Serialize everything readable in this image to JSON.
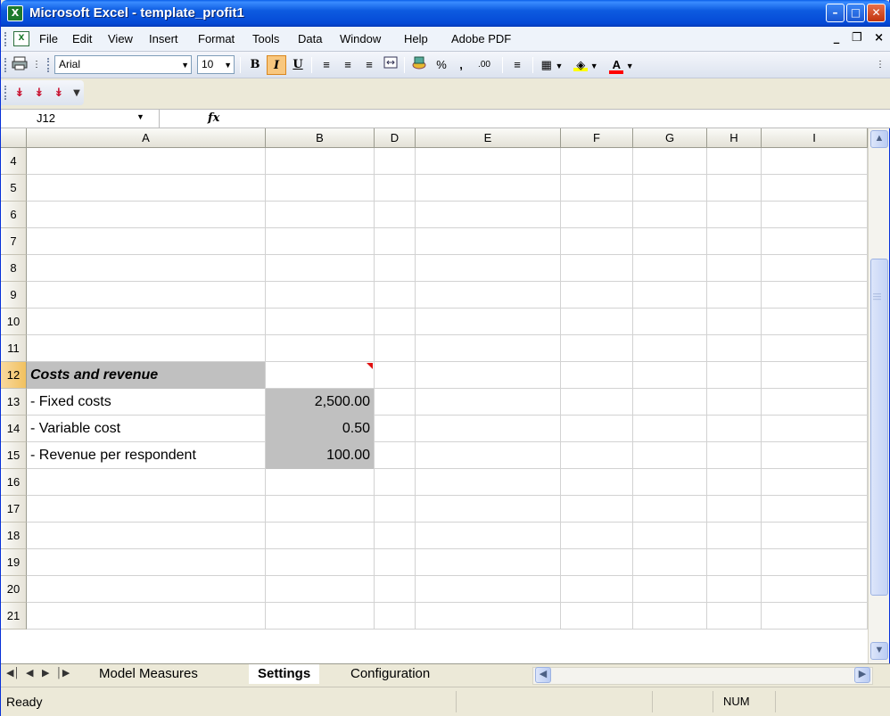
{
  "window": {
    "title": "Microsoft Excel - template_profit1",
    "app_icon": "excel-icon",
    "min_label": "–",
    "max_label": "□",
    "close_label": "✕"
  },
  "menu": {
    "items": [
      "File",
      "Edit",
      "View",
      "Insert",
      "Format",
      "Tools",
      "Data",
      "Window",
      "Help",
      "Adobe PDF"
    ],
    "doc_min": "_",
    "doc_restore": "❐",
    "doc_close": "×"
  },
  "toolbar": {
    "font_name": "Arial",
    "font_size": "10",
    "bold": "B",
    "italic": "I",
    "underline": "U",
    "percent": "%",
    "comma": ",",
    "increase_decimal": ".00",
    "fill_color": "#FFFF00",
    "font_color": "#FF0000"
  },
  "formula_bar": {
    "name_box": "J12",
    "fx_label": "fx",
    "formula": ""
  },
  "grid": {
    "columns": [
      "A",
      "B",
      "D",
      "E",
      "F",
      "G",
      "H",
      "I"
    ],
    "rows": [
      {
        "num": "4",
        "a": "",
        "b": ""
      },
      {
        "num": "5",
        "a": "",
        "b": ""
      },
      {
        "num": "6",
        "a": "",
        "b": ""
      },
      {
        "num": "7",
        "a": "",
        "b": ""
      },
      {
        "num": "8",
        "a": "",
        "b": ""
      },
      {
        "num": "9",
        "a": "",
        "b": ""
      },
      {
        "num": "10",
        "a": "",
        "b": ""
      },
      {
        "num": "11",
        "a": "",
        "b": ""
      },
      {
        "num": "12",
        "a": "Costs and revenue",
        "b": ""
      },
      {
        "num": "13",
        "a": "- Fixed costs",
        "b": "2,500.00"
      },
      {
        "num": "14",
        "a": "- Variable cost",
        "b": "0.50"
      },
      {
        "num": "15",
        "a": "- Revenue per respondent",
        "b": "100.00"
      },
      {
        "num": "16",
        "a": "",
        "b": ""
      },
      {
        "num": "17",
        "a": "",
        "b": ""
      },
      {
        "num": "18",
        "a": "",
        "b": ""
      },
      {
        "num": "19",
        "a": "",
        "b": ""
      },
      {
        "num": "20",
        "a": "",
        "b": ""
      },
      {
        "num": "21",
        "a": "",
        "b": ""
      }
    ],
    "shade_color": "#C0C0C0"
  },
  "sheets": {
    "tabs": [
      "Model Measures",
      "Settings",
      "Configuration"
    ],
    "active": "Settings"
  },
  "status": {
    "text": "Ready",
    "num_indicator": "NUM"
  }
}
